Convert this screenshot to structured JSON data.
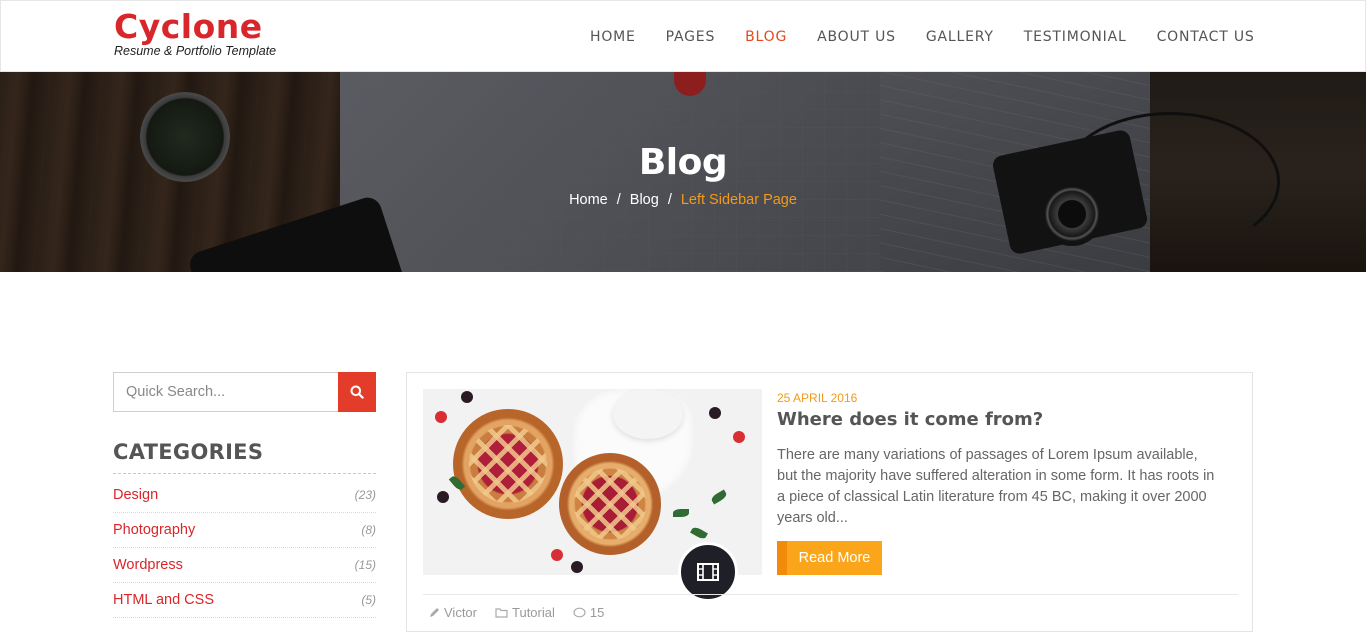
{
  "brand": {
    "title": "Cyclone",
    "tagline": "Resume & Portfolio Template"
  },
  "nav": {
    "items": [
      {
        "label": "HOME"
      },
      {
        "label": "PAGES"
      },
      {
        "label": "BLOG",
        "active": true
      },
      {
        "label": "ABOUT US"
      },
      {
        "label": "GALLERY"
      },
      {
        "label": "TESTIMONIAL"
      },
      {
        "label": "CONTACT US"
      }
    ]
  },
  "hero": {
    "title": "Blog",
    "breadcrumb": {
      "home": "Home",
      "sep": "/",
      "blog": "Blog",
      "current": "Left Sidebar Page"
    }
  },
  "sidebar": {
    "search": {
      "placeholder": "Quick Search..."
    },
    "categories_title": "CATEGORIES",
    "categories": [
      {
        "name": "Design",
        "count": "(23)"
      },
      {
        "name": "Photography",
        "count": "(8)"
      },
      {
        "name": "Wordpress",
        "count": "(15)"
      },
      {
        "name": "HTML and CSS",
        "count": "(5)"
      }
    ]
  },
  "post": {
    "date": "25 APRIL 2016",
    "title": "Where does it come from?",
    "excerpt": "There are many variations of passages of Lorem Ipsum available, but the majority have suffered alteration in some form. It has roots in a piece of classical Latin literature from 45 BC, making it over 2000 years old...",
    "read_more": "Read More",
    "meta": {
      "author": "Victor",
      "category": "Tutorial",
      "comments": "15"
    }
  },
  "colors": {
    "brand": "#d9262a",
    "accent": "#f29a1b",
    "nav_active": "#e24a1d",
    "button": "#fba61a",
    "search_btn": "#e43c2a"
  }
}
